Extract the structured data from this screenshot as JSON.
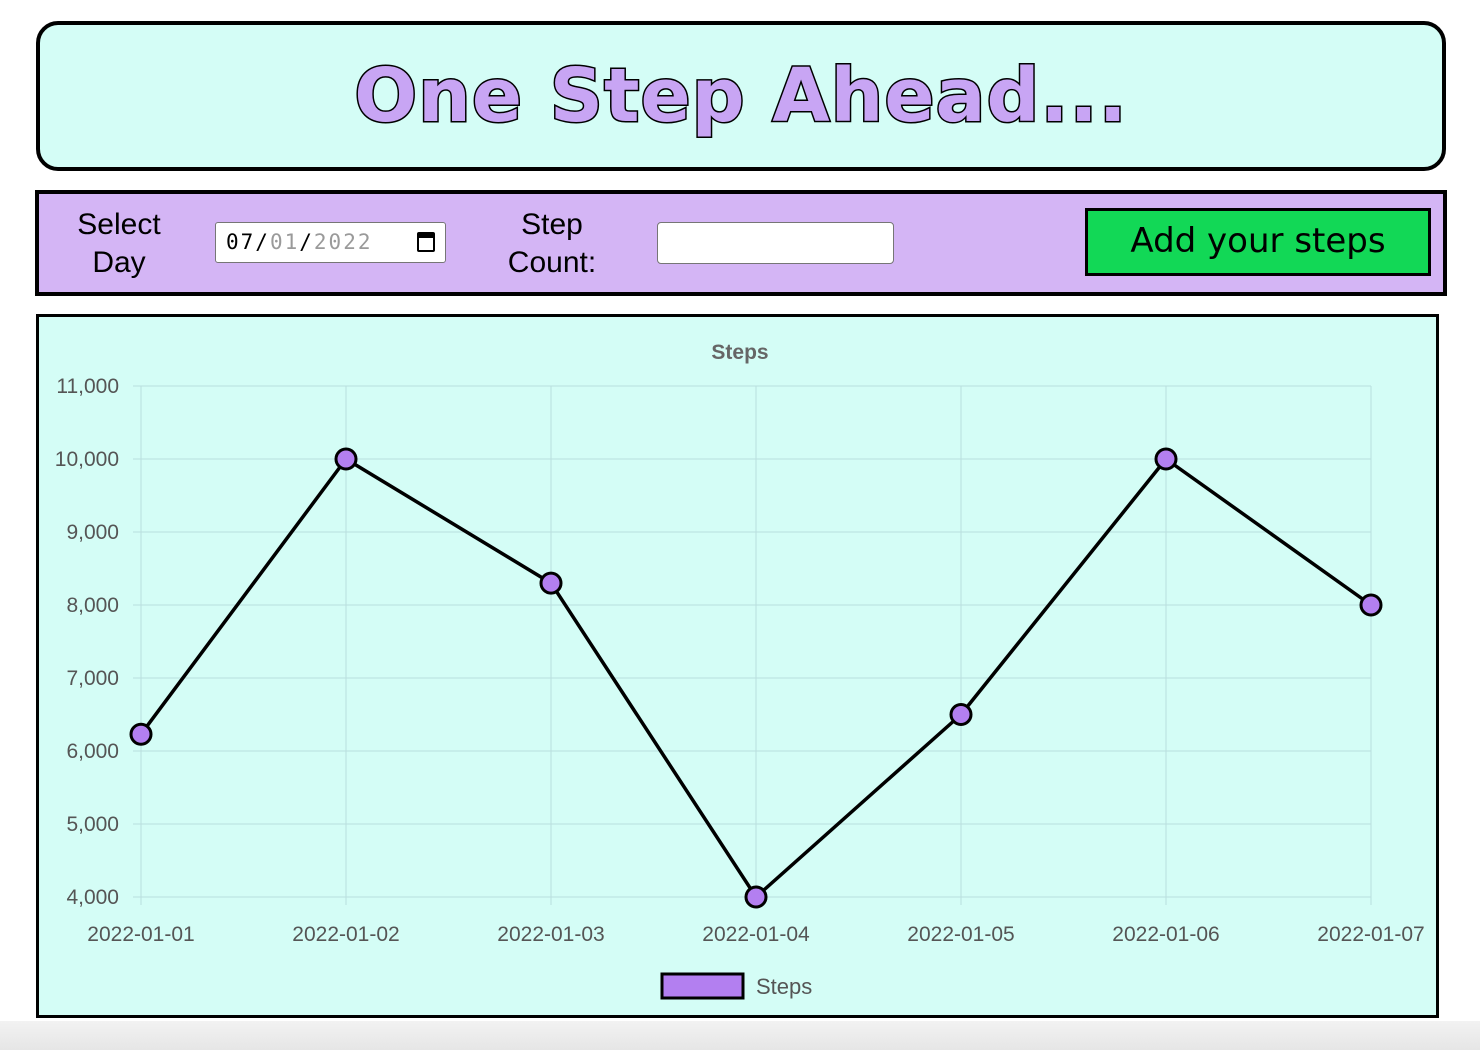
{
  "header": {
    "title": "One Step Ahead..."
  },
  "form": {
    "select_day_label": "Select Day",
    "date_value": {
      "month": "07",
      "day": "01",
      "year": "2022"
    },
    "step_count_label": "Step Count:",
    "step_count_value": "",
    "submit_label": "Add your steps"
  },
  "colors": {
    "header_bg": "#d4fdf6",
    "title_fill": "#c8a5f4",
    "form_bg": "#d4b5f5",
    "button_bg": "#12d856",
    "chart_bg": "#d4fdf6",
    "point_fill": "#b37ff0",
    "line": "#000000",
    "grid": "#b9dede"
  },
  "chart_data": {
    "type": "line",
    "title": "Steps",
    "categories": [
      "2022-01-01",
      "2022-01-02",
      "2022-01-03",
      "2022-01-04",
      "2022-01-05",
      "2022-01-06",
      "2022-01-07"
    ],
    "series": [
      {
        "name": "Steps",
        "values": [
          6230,
          10000,
          8300,
          4000,
          6500,
          10000,
          8000
        ]
      }
    ],
    "ylim": [
      4000,
      11000
    ],
    "yticks": [
      "4,000",
      "5,000",
      "6,000",
      "7,000",
      "8,000",
      "9,000",
      "10,000",
      "11,000"
    ],
    "grid": true,
    "legend": "bottom"
  }
}
